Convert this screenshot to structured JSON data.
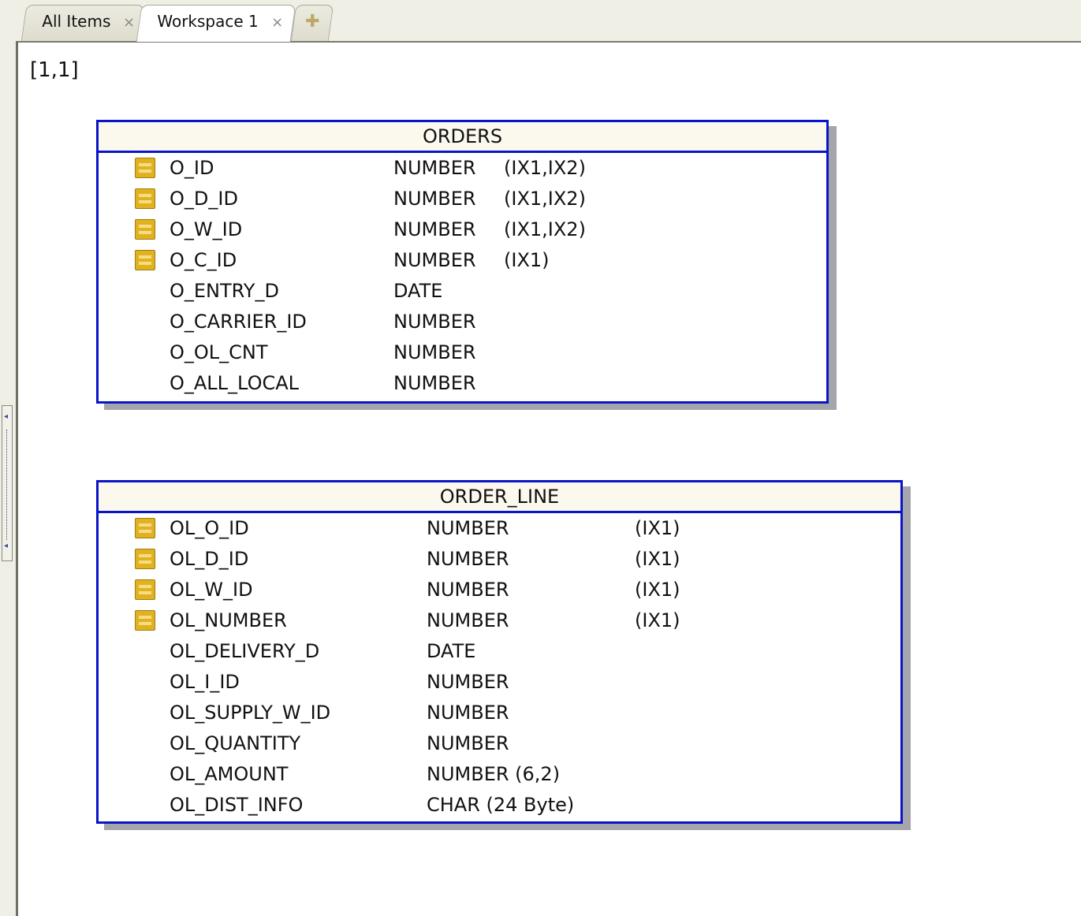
{
  "tabs": [
    {
      "label": "All Items",
      "close": "×"
    },
    {
      "label": "Workspace 1",
      "close": "×"
    },
    {
      "label": "✚"
    }
  ],
  "canvas": {
    "coordinate": "[1,1]"
  },
  "tables": [
    {
      "name": "ORDERS",
      "columns": [
        {
          "name": "O_ID",
          "type": "NUMBER",
          "index": "(IX1,IX2)",
          "key": true
        },
        {
          "name": "O_D_ID",
          "type": "NUMBER",
          "index": "(IX1,IX2)",
          "key": true
        },
        {
          "name": "O_W_ID",
          "type": "NUMBER",
          "index": "(IX1,IX2)",
          "key": true
        },
        {
          "name": "O_C_ID",
          "type": "NUMBER",
          "index": "(IX1)",
          "key": true
        },
        {
          "name": "O_ENTRY_D",
          "type": "DATE",
          "index": "",
          "key": false
        },
        {
          "name": "O_CARRIER_ID",
          "type": "NUMBER",
          "index": "",
          "key": false
        },
        {
          "name": "O_OL_CNT",
          "type": "NUMBER",
          "index": "",
          "key": false
        },
        {
          "name": "O_ALL_LOCAL",
          "type": "NUMBER",
          "index": "",
          "key": false
        }
      ]
    },
    {
      "name": "ORDER_LINE",
      "columns": [
        {
          "name": "OL_O_ID",
          "type": "NUMBER",
          "index": "(IX1)",
          "key": true
        },
        {
          "name": "OL_D_ID",
          "type": "NUMBER",
          "index": "(IX1)",
          "key": true
        },
        {
          "name": "OL_W_ID",
          "type": "NUMBER",
          "index": "(IX1)",
          "key": true
        },
        {
          "name": "OL_NUMBER",
          "type": "NUMBER",
          "index": "(IX1)",
          "key": true
        },
        {
          "name": "OL_DELIVERY_D",
          "type": "DATE",
          "index": "",
          "key": false
        },
        {
          "name": "OL_I_ID",
          "type": "NUMBER",
          "index": "",
          "key": false
        },
        {
          "name": "OL_SUPPLY_W_ID",
          "type": "NUMBER",
          "index": "",
          "key": false
        },
        {
          "name": "OL_QUANTITY",
          "type": "NUMBER",
          "index": "",
          "key": false
        },
        {
          "name": "OL_AMOUNT",
          "type": "NUMBER (6,2)",
          "index": "",
          "key": false
        },
        {
          "name": "OL_DIST_INFO",
          "type": "CHAR (24 Byte)",
          "index": "",
          "key": false
        }
      ]
    }
  ],
  "colors": {
    "table_border": "#0a14c8",
    "key_icon": "#e1b21f",
    "header_bg": "#fbf8ee"
  }
}
